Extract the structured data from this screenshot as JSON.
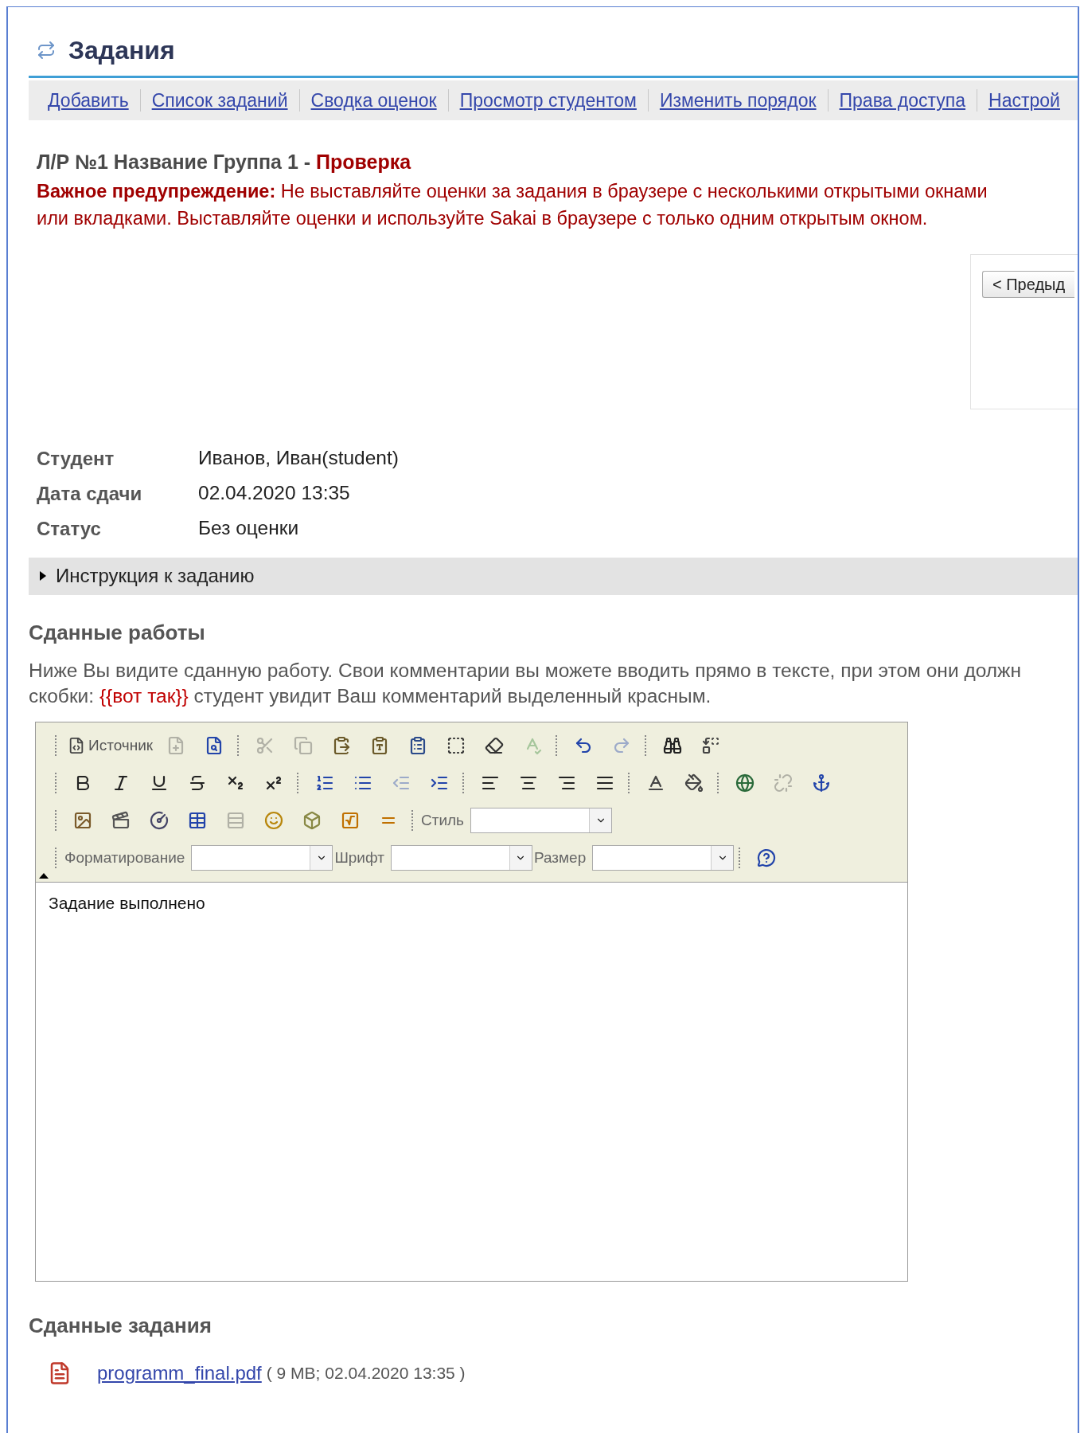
{
  "header": {
    "title": "Задания"
  },
  "nav": [
    "Добавить",
    "Список заданий",
    "Сводка оценок",
    "Просмотр студентом",
    "Изменить порядок",
    "Права доступа",
    "Настрой"
  ],
  "heading": {
    "title": "Л/Р №1 Название Группа 1 - ",
    "mode": "Проверка"
  },
  "warning": "**Важное предупреждение:** Не выставляйте оценки за задания в браузере с несколькими открытыми окнами или вкладками. Выставляйте оценки и используйте Sakai в браузере с только одним открытым окном.",
  "pager": {
    "prev_button": "< Предыд"
  },
  "details": [
    {
      "label": "Студент",
      "value": "Иванов, Иван(student)"
    },
    {
      "label": "Дата сдачи",
      "value": "02.04.2020 13:35"
    },
    {
      "label": "Статус",
      "value": "Без оценки"
    }
  ],
  "instructions": {
    "label": "Инструкция к заданию",
    "expanded": false
  },
  "submitted_work": {
    "title": "Сданные работы",
    "line1": "Ниже Вы видите сданную работу. Свои комментарии вы можете вводить прямо в тексте, при этом они должн",
    "line2_start": "скобки: ",
    "highlight": "{{вот так}}",
    "line2_end": " студент увидит Ваш комментарий выделенный красным."
  },
  "editor": {
    "toolbar": [
      [
        [
          {
            "kind": "source",
            "label": "Источник",
            "disabled": false
          },
          {
            "kind": "newpage",
            "disabled": true
          },
          {
            "kind": "preview",
            "disabled": false
          }
        ],
        [
          {
            "kind": "cut",
            "disabled": true
          },
          {
            "kind": "copy",
            "disabled": true
          },
          {
            "kind": "paste",
            "disabled": false
          },
          {
            "kind": "pastetext",
            "disabled": false
          },
          {
            "kind": "pasteword",
            "disabled": false
          },
          {
            "kind": "selectall",
            "disabled": false
          },
          {
            "kind": "removeformat",
            "disabled": false
          },
          {
            "kind": "spellcheck",
            "disabled": true
          }
        ],
        [
          {
            "kind": "undo",
            "disabled": false
          },
          {
            "kind": "redo",
            "disabled": true
          }
        ],
        [
          {
            "kind": "find",
            "disabled": false
          },
          {
            "kind": "replace",
            "disabled": false
          }
        ]
      ],
      [
        [
          {
            "kind": "bold",
            "disabled": false
          },
          {
            "kind": "italic",
            "disabled": false
          },
          {
            "kind": "underline",
            "disabled": false
          },
          {
            "kind": "strike",
            "disabled": false
          },
          {
            "kind": "subscript",
            "disabled": false
          },
          {
            "kind": "superscript",
            "disabled": false
          }
        ],
        [
          {
            "kind": "numberedlist",
            "disabled": false
          },
          {
            "kind": "bulletlist",
            "disabled": false
          },
          {
            "kind": "outdent",
            "disabled": true
          },
          {
            "kind": "indent",
            "disabled": false
          }
        ],
        [
          {
            "kind": "alignleft",
            "disabled": false
          },
          {
            "kind": "aligncenter",
            "disabled": false
          },
          {
            "kind": "alignright",
            "disabled": false
          },
          {
            "kind": "justify",
            "disabled": false
          }
        ],
        [
          {
            "kind": "textcolor",
            "disabled": false
          },
          {
            "kind": "bgcolor",
            "disabled": false
          }
        ],
        [
          {
            "kind": "link",
            "disabled": false
          },
          {
            "kind": "unlink",
            "disabled": true
          },
          {
            "kind": "anchor",
            "disabled": false
          }
        ]
      ],
      [
        [
          {
            "kind": "image",
            "disabled": false
          },
          {
            "kind": "movie",
            "disabled": false
          },
          {
            "kind": "flash",
            "disabled": false
          },
          {
            "kind": "table",
            "disabled": false
          },
          {
            "kind": "hrule",
            "disabled": true
          },
          {
            "kind": "smiley",
            "disabled": false
          },
          {
            "kind": "specialchar",
            "disabled": false
          },
          {
            "kind": "math",
            "disabled": false
          },
          {
            "kind": "equation",
            "disabled": false
          }
        ],
        [
          {
            "kind": "combo",
            "label": "Стиль",
            "disabled": false
          }
        ]
      ],
      [
        [
          {
            "kind": "combo",
            "label": "Форматирование",
            "disabled": false
          },
          {
            "kind": "combo",
            "label": "Шрифт",
            "disabled": false
          },
          {
            "kind": "combo",
            "label": "Размер",
            "disabled": false
          }
        ],
        [
          {
            "kind": "help",
            "disabled": false
          }
        ]
      ]
    ],
    "content": "Задание выполнено"
  },
  "submitted_files": {
    "title": "Сданные задания",
    "files": [
      {
        "name": "programm_final.pdf",
        "meta": "( 9 MB; 02.04.2020 13:35 )"
      }
    ]
  }
}
